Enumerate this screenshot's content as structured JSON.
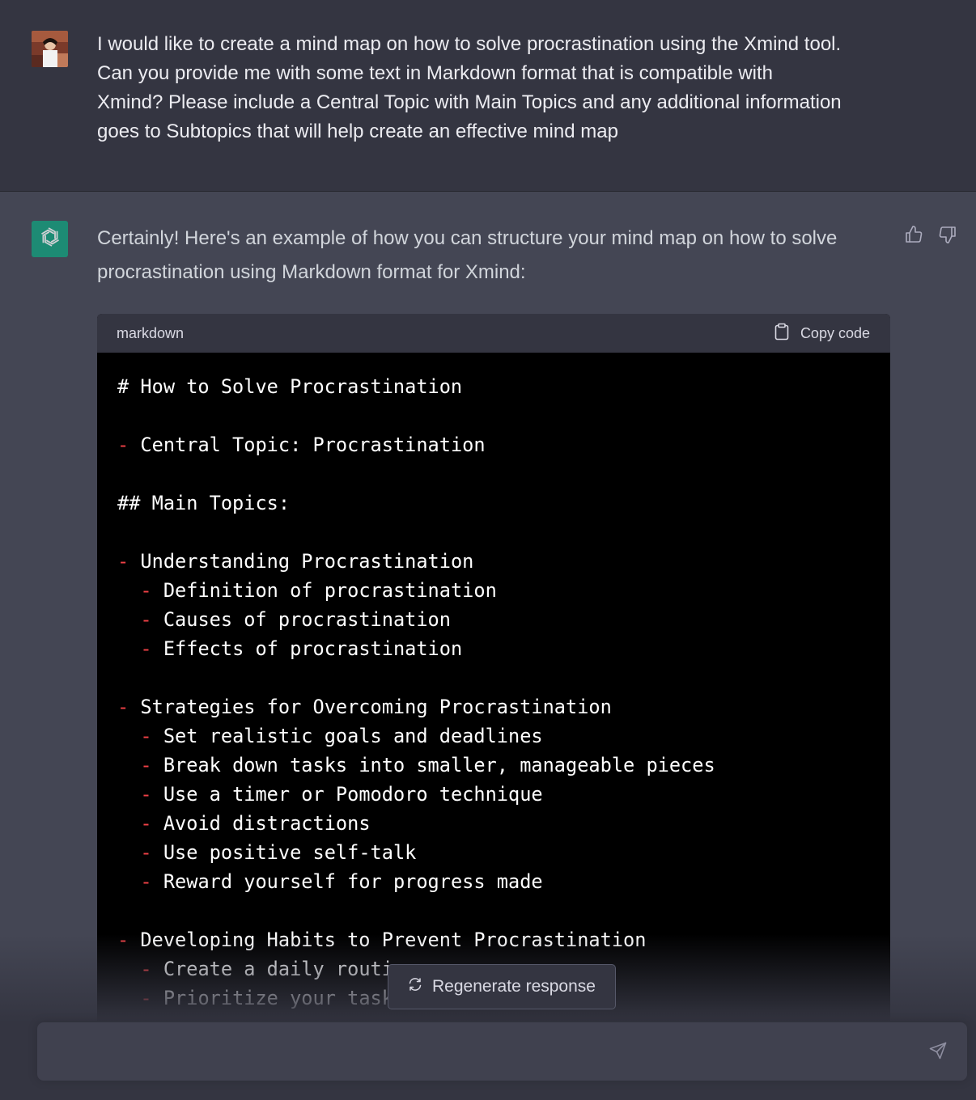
{
  "user_message": {
    "lines": [
      "I would like to create a mind map on how to solve procrastination using the Xmind tool.",
      "Can you provide me with some text in Markdown format that is compatible with",
      "Xmind? Please include a Central Topic with Main Topics and any additional information",
      "goes to Subtopics that will help create an effective mind map"
    ]
  },
  "assistant_message": {
    "intro_lines": [
      "Certainly! Here's an example of how you can structure your mind map on how to solve",
      "procrastination using Markdown format for Xmind:"
    ],
    "code_block": {
      "language": "markdown",
      "copy_label": "Copy code",
      "lines": [
        {
          "indent": "",
          "bullet": "",
          "text": "# How to Solve Procrastination"
        },
        {
          "indent": "",
          "bullet": "",
          "text": ""
        },
        {
          "indent": "",
          "bullet": "-",
          "text": " Central Topic: Procrastination"
        },
        {
          "indent": "",
          "bullet": "",
          "text": ""
        },
        {
          "indent": "",
          "bullet": "",
          "text": "## Main Topics:"
        },
        {
          "indent": "",
          "bullet": "",
          "text": ""
        },
        {
          "indent": "",
          "bullet": "-",
          "text": " Understanding Procrastination"
        },
        {
          "indent": "  ",
          "bullet": "-",
          "text": " Definition of procrastination"
        },
        {
          "indent": "  ",
          "bullet": "-",
          "text": " Causes of procrastination"
        },
        {
          "indent": "  ",
          "bullet": "-",
          "text": " Effects of procrastination"
        },
        {
          "indent": "",
          "bullet": "",
          "text": ""
        },
        {
          "indent": "",
          "bullet": "-",
          "text": " Strategies for Overcoming Procrastination"
        },
        {
          "indent": "  ",
          "bullet": "-",
          "text": " Set realistic goals and deadlines"
        },
        {
          "indent": "  ",
          "bullet": "-",
          "text": " Break down tasks into smaller, manageable pieces"
        },
        {
          "indent": "  ",
          "bullet": "-",
          "text": " Use a timer or Pomodoro technique"
        },
        {
          "indent": "  ",
          "bullet": "-",
          "text": " Avoid distractions"
        },
        {
          "indent": "  ",
          "bullet": "-",
          "text": " Use positive self-talk"
        },
        {
          "indent": "  ",
          "bullet": "-",
          "text": " Reward yourself for progress made"
        },
        {
          "indent": "",
          "bullet": "",
          "text": ""
        },
        {
          "indent": "",
          "bullet": "-",
          "text": " Developing Habits to Prevent Procrastination"
        },
        {
          "indent": "  ",
          "bullet": "-",
          "text": " Create a daily routine"
        },
        {
          "indent": "  ",
          "bullet": "-",
          "text": " Prioritize your tasks"
        }
      ]
    }
  },
  "regenerate_label": "Regenerate response",
  "input": {
    "value": "",
    "placeholder": ""
  },
  "icons": {
    "thumbs_up": "thumbs-up-icon",
    "thumbs_down": "thumbs-down-icon",
    "clipboard": "clipboard-icon",
    "regenerate": "refresh-icon",
    "send": "send-icon",
    "assistant_logo": "openai-logo-icon"
  },
  "colors": {
    "user_bg": "#343541",
    "assistant_bg": "#444654",
    "code_bg": "#000000",
    "bullet": "#ef4146",
    "assistant_avatar": "#10a37f"
  }
}
